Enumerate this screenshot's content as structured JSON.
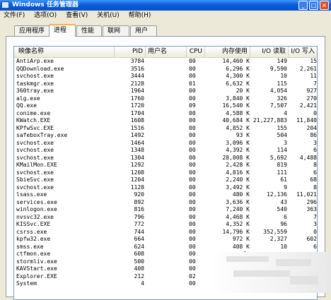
{
  "window": {
    "title": "Windows 任务管理器"
  },
  "menu": [
    "文件(F)",
    "选项(O)",
    "查看(V)",
    "关机(U)",
    "帮助(H)"
  ],
  "tabs": [
    {
      "label": "应用程序",
      "active": false
    },
    {
      "label": "进程",
      "active": true
    },
    {
      "label": "性能",
      "active": false
    },
    {
      "label": "联网",
      "active": false
    },
    {
      "label": "用户",
      "active": false
    }
  ],
  "columns": {
    "name": "映像名称",
    "pid": "PID",
    "user": "用户名",
    "cpu": "CPU",
    "mem": "内存使用",
    "read": "I/O 读取",
    "write": "I/O 写入"
  },
  "processes": [
    {
      "name": "AntiArp.exe",
      "pid": "3784",
      "user": "",
      "cpu": "00",
      "mem": "14,460 K",
      "read": "149",
      "write": "15"
    },
    {
      "name": "QQDownload.exe",
      "pid": "3516",
      "user": "",
      "cpu": "00",
      "mem": "6,296 K",
      "read": "9,590",
      "write": "2,261"
    },
    {
      "name": "svchost.exe",
      "pid": "3444",
      "user": "",
      "cpu": "00",
      "mem": "4,300 K",
      "read": "10",
      "write": "11"
    },
    {
      "name": "taskmgr.exe",
      "pid": "2128",
      "user": "",
      "cpu": "01",
      "mem": "6,632 K",
      "read": "115",
      "write": "7"
    },
    {
      "name": "360tray.exe",
      "pid": "1964",
      "user": "",
      "cpu": "00",
      "mem": "20 K",
      "read": "4,054",
      "write": "927"
    },
    {
      "name": "alg.exe",
      "pid": "1760",
      "user": "",
      "cpu": "00",
      "mem": "3,840 K",
      "read": "326",
      "write": "270"
    },
    {
      "name": "QQ.exe",
      "pid": "1720",
      "user": "",
      "cpu": "09",
      "mem": "16,540 K",
      "read": "7,507",
      "write": "2,421"
    },
    {
      "name": "conime.exe",
      "pid": "1704",
      "user": "",
      "cpu": "00",
      "mem": "4,588 K",
      "read": "4",
      "write": "0"
    },
    {
      "name": "KWatch.EXE",
      "pid": "1608",
      "user": "",
      "cpu": "00",
      "mem": "40,684 K",
      "read": "21,227,883",
      "write": "11,840"
    },
    {
      "name": "KPfwSvc.EXE",
      "pid": "1516",
      "user": "",
      "cpu": "00",
      "mem": "4,852 K",
      "read": "155",
      "write": "204"
    },
    {
      "name": "safeboxTray.exe",
      "pid": "1492",
      "user": "",
      "cpu": "00",
      "mem": "93 K",
      "read": "504",
      "write": "86"
    },
    {
      "name": "svchost.exe",
      "pid": "1464",
      "user": "",
      "cpu": "00",
      "mem": "3,096 K",
      "read": "3",
      "write": "3"
    },
    {
      "name": "svchost.exe",
      "pid": "1348",
      "user": "",
      "cpu": "00",
      "mem": "4,392 K",
      "read": "114",
      "write": "6"
    },
    {
      "name": "svchost.exe",
      "pid": "1304",
      "user": "",
      "cpu": "00",
      "mem": "28,008 K",
      "read": "5,692",
      "write": "4,488"
    },
    {
      "name": "KMailMon.EXE",
      "pid": "1292",
      "user": "",
      "cpu": "00",
      "mem": "2,428 K",
      "read": "819",
      "write": "8"
    },
    {
      "name": "svchost.exe",
      "pid": "1208",
      "user": "",
      "cpu": "00",
      "mem": "4,816 K",
      "read": "111",
      "write": "6"
    },
    {
      "name": "SbieSvc.exe",
      "pid": "1204",
      "user": "",
      "cpu": "00",
      "mem": "2,240 K",
      "read": "61",
      "write": "68"
    },
    {
      "name": "svchost.exe",
      "pid": "1128",
      "user": "",
      "cpu": "00",
      "mem": "3,492 K",
      "read": "9",
      "write": "8"
    },
    {
      "name": "lsass.exe",
      "pid": "920",
      "user": "",
      "cpu": "00",
      "mem": "480 K",
      "read": "12,136",
      "write": "11,021"
    },
    {
      "name": "services.exe",
      "pid": "892",
      "user": "",
      "cpu": "00",
      "mem": "3,636 K",
      "read": "43",
      "write": "296"
    },
    {
      "name": "winlogon.exe",
      "pid": "816",
      "user": "",
      "cpu": "00",
      "mem": "7,240 K",
      "read": "540",
      "write": "363"
    },
    {
      "name": "nvsvc32.exe",
      "pid": "796",
      "user": "",
      "cpu": "00",
      "mem": "4,468 K",
      "read": "6",
      "write": "7"
    },
    {
      "name": "KISSvc.EXE",
      "pid": "772",
      "user": "",
      "cpu": "00",
      "mem": "4,352 K",
      "read": "96",
      "write": "3"
    },
    {
      "name": "csrss.exe",
      "pid": "744",
      "user": "",
      "cpu": "00",
      "mem": "14,796 K",
      "read": "352,559",
      "write": "0"
    },
    {
      "name": "kpfw32.exe",
      "pid": "664",
      "user": "",
      "cpu": "00",
      "mem": "972 K",
      "read": "2,327",
      "write": "602"
    },
    {
      "name": "smss.exe",
      "pid": "624",
      "user": "",
      "cpu": "00",
      "mem": "408 K",
      "read": "10",
      "write": "6"
    },
    {
      "name": "ctfmon.exe",
      "pid": "608",
      "user": "",
      "cpu": "00",
      "mem": "4,",
      "read": "",
      "write": ""
    },
    {
      "name": "stormliv.exe",
      "pid": "500",
      "user": "",
      "cpu": "00",
      "mem": "1,",
      "read": "",
      "write": ""
    },
    {
      "name": "KAVStart.exe",
      "pid": "408",
      "user": "",
      "cpu": "00",
      "mem": "1,",
      "read": "",
      "write": ""
    },
    {
      "name": "Explorer.EXE",
      "pid": "212",
      "user": "",
      "cpu": "02",
      "mem": "19,",
      "read": "",
      "write": ""
    },
    {
      "name": "System",
      "pid": "4",
      "user": "",
      "cpu": "00",
      "mem": "",
      "read": "",
      "write": ""
    }
  ]
}
